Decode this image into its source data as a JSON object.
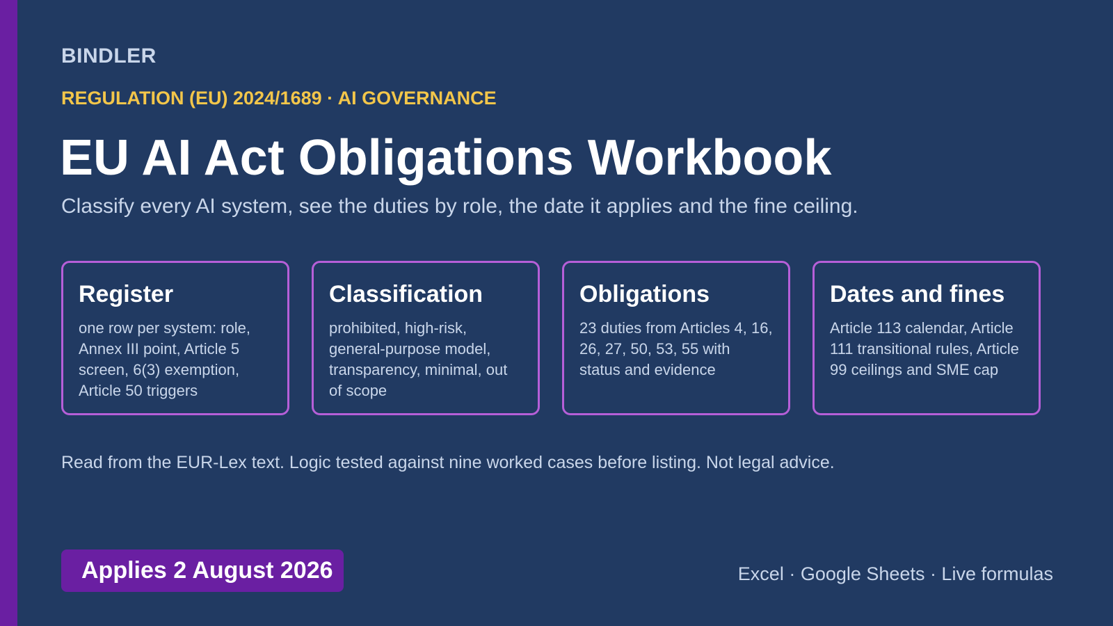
{
  "brand": "BINDLER",
  "kicker": "REGULATION (EU) 2024/1689 · AI GOVERNANCE",
  "title": "EU AI Act Obligations Workbook",
  "subtitle": "Classify every AI system, see the duties by role, the date it applies and the fine ceiling.",
  "cards": [
    {
      "title": "Register",
      "body": "one row per system: role, Annex III point, Article 5 screen, 6(3) exemption, Article 50 triggers"
    },
    {
      "title": "Classification",
      "body": "prohibited, high-risk, general-purpose model, transparency, minimal, out of scope"
    },
    {
      "title": "Obligations",
      "body": "23 duties from Articles 4, 16, 26, 27, 50, 53, 55 with status and evidence"
    },
    {
      "title": "Dates and fines",
      "body": "Article 113 calendar, Article 111 transitional rules, Article 99 ceilings and SME cap"
    }
  ],
  "note": "Read from the EUR-Lex text. Logic tested against nine worked cases before listing. Not legal advice.",
  "badge": "Applies 2 August 2026",
  "formats": "Excel · Google Sheets · Live formulas",
  "colors": {
    "background": "#213a62",
    "accent_purple": "#6a1fa2",
    "card_border": "#b65fd8",
    "kicker_yellow": "#f3c64a",
    "muted_text": "#c9d6ea"
  }
}
